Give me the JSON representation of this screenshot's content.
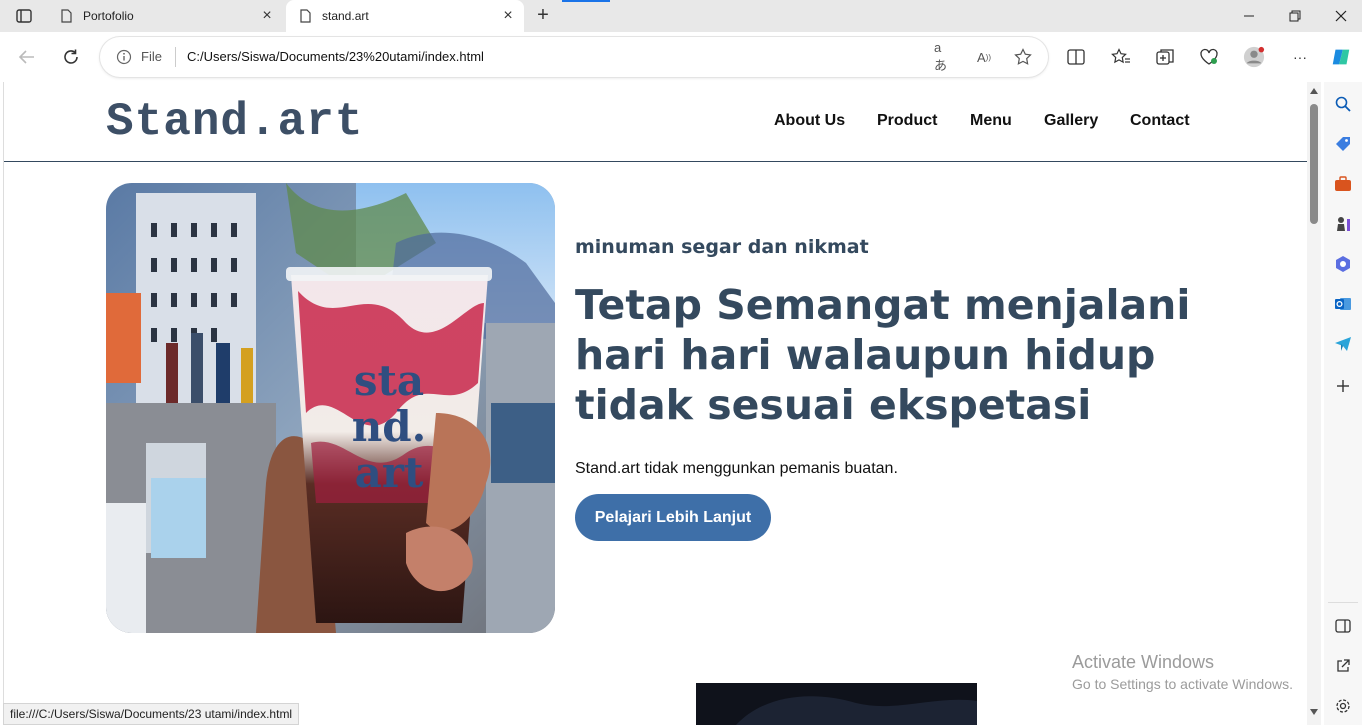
{
  "browser": {
    "tabs": [
      {
        "title": "Portofolio",
        "active": false
      },
      {
        "title": "stand.art",
        "active": true
      }
    ],
    "omnibox": {
      "scheme_label": "File",
      "url": "C:/Users/Siswa/Documents/23%20utami/index.html"
    },
    "status_url": "file:///C:/Users/Siswa/Documents/23 utami/index.html"
  },
  "site": {
    "logo": "Stand.art",
    "nav": [
      "About Us",
      "Product",
      "Menu",
      "Gallery",
      "Contact"
    ],
    "hero": {
      "tagline": "minuman segar dan nikmat",
      "headline": "Tetap Semangat menjalani hari hari walaupun hidup tidak sesuai ekspetasi",
      "description": "Stand.art tidak menggunkan pemanis buatan.",
      "cta_label": "Pelajari Lebih Lanjut",
      "cup_print": [
        "sta",
        "nd.",
        "art"
      ]
    }
  },
  "overlay": {
    "activate_title": "Activate Windows",
    "activate_subtitle": "Go to Settings to activate Windows."
  },
  "colors": {
    "brand_text": "#34495e",
    "cta_background": "#3e6fa8"
  }
}
